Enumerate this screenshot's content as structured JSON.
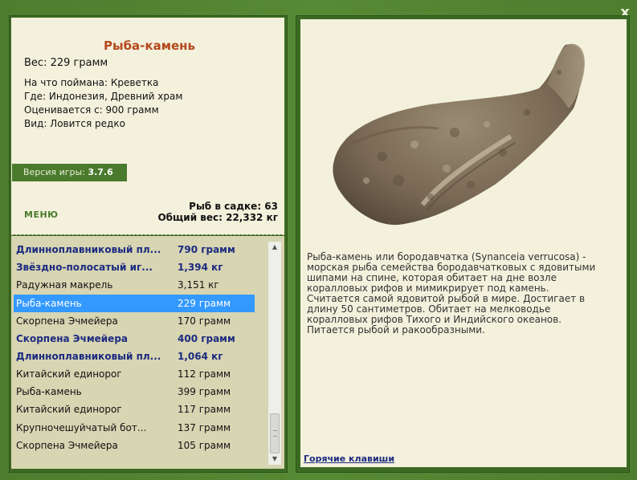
{
  "window": {
    "close_label": "x"
  },
  "fish": {
    "title": "Рыба-камень",
    "weight_line": "Вес: 229 грамм",
    "details": [
      "На что поймана: Креветка",
      "Где: Индонезия, Древний храм",
      "Оценивается с: 900 грамм",
      "Вид: Ловится редко"
    ],
    "description": "Рыба-камень или бородавчатка (Synanceia verrucosa) - морская рыба семейства бородавчатковых с ядовитыми шипами на спине, которая обитает на дне возле коралловых рифов и мимикрирует под камень. Считается самой ядовитой рыбой в мире. Достигает в длину 50 сантиметров. Обитает на мелководье коралловых рифов Тихого и Индийского океанов. Питается рыбой и ракообразными."
  },
  "version": {
    "label": "Версия игры:",
    "value": "3.7.6"
  },
  "menu_label": "МЕНЮ",
  "stats": {
    "count_line": "Рыб в садке: 63",
    "total_line": "Общий вес: 22,332 кг"
  },
  "list": [
    {
      "name": "Длиннoплавниковый пл...",
      "weight": "790 грамм",
      "bold": true,
      "selected": false
    },
    {
      "name": "Звёздно-полосатый иг...",
      "weight": "1,394 кг",
      "bold": true,
      "selected": false
    },
    {
      "name": "Радужная макрель",
      "weight": "3,151 кг",
      "bold": false,
      "selected": false
    },
    {
      "name": "Рыба-камень",
      "weight": "229 грамм",
      "bold": false,
      "selected": true
    },
    {
      "name": "Скорпена Эчмейера",
      "weight": "170 грамм",
      "bold": false,
      "selected": false
    },
    {
      "name": "Скорпена Эчмейера",
      "weight": "400 грамм",
      "bold": true,
      "selected": false
    },
    {
      "name": "Длиннoплавниковый пл...",
      "weight": "1,064 кг",
      "bold": true,
      "selected": false
    },
    {
      "name": "Китайский единорог",
      "weight": "112 грамм",
      "bold": false,
      "selected": false
    },
    {
      "name": "Рыба-камень",
      "weight": "399 грамм",
      "bold": false,
      "selected": false
    },
    {
      "name": "Китайский единорог",
      "weight": "117 грамм",
      "bold": false,
      "selected": false
    },
    {
      "name": "Крупночешуйчатый бот...",
      "weight": "137 грамм",
      "bold": false,
      "selected": false
    },
    {
      "name": "Скорпена Эчмейера",
      "weight": "105 грамм",
      "bold": false,
      "selected": false
    }
  ],
  "hotkeys_label": "Горячие клавиши",
  "colors": {
    "frame": "#4a7a2c",
    "panel": "#f3f1dc",
    "list_bg": "#d7d5b2",
    "title": "#b5471c",
    "bold_row": "#1c2a80",
    "selection": "#3399ff"
  }
}
